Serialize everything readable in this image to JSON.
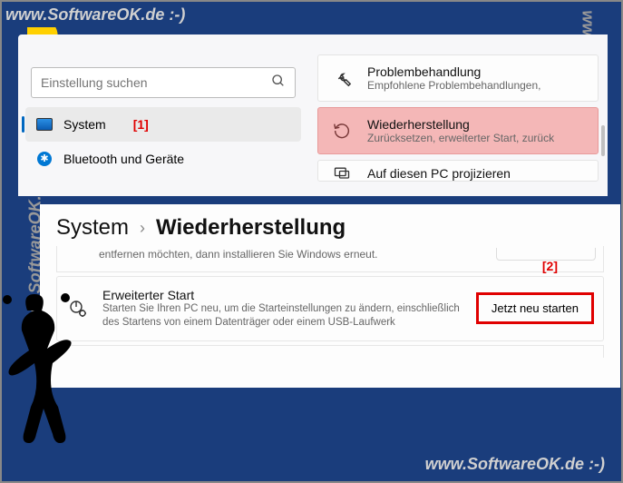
{
  "watermark": "www.SoftwareOK.de :-)",
  "search": {
    "placeholder": "Einstellung suchen"
  },
  "sidebar": {
    "items": [
      {
        "label": "System",
        "marker": "[1]"
      },
      {
        "label": "Bluetooth und Geräte"
      }
    ]
  },
  "tiles": {
    "troubleshoot": {
      "title": "Problembehandlung",
      "sub": "Empfohlene Problembehandlungen,"
    },
    "recovery": {
      "title": "Wiederherstellung",
      "sub": "Zurücksetzen, erweiterter Start, zurück"
    },
    "project": {
      "title": "Auf diesen PC projizieren"
    }
  },
  "breadcrumb": {
    "parent": "System",
    "current": "Wiederherstellung"
  },
  "reset_fragment": "entfernen möchten, dann installieren Sie Windows erneut.",
  "advanced": {
    "title": "Erweiterter Start",
    "desc": "Starten Sie Ihren PC neu, um die Starteinstellungen zu ändern, einschließlich des Startens von einem Datenträger oder einem USB-Laufwerk",
    "button": "Jetzt neu starten",
    "marker": "[2]"
  }
}
